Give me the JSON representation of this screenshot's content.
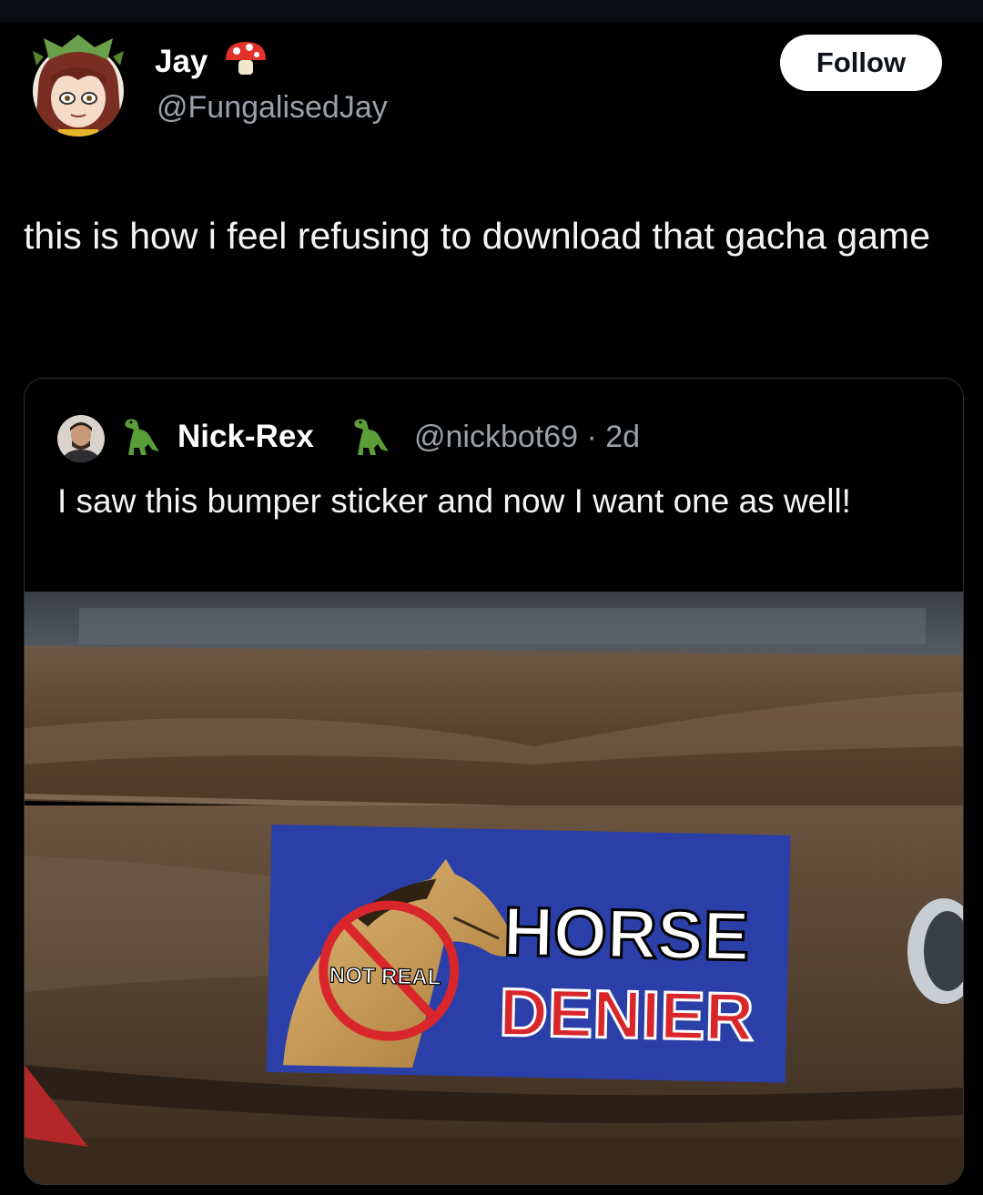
{
  "post": {
    "author_name": "Jay",
    "author_handle": "@FungalisedJay",
    "follow_label": "Follow",
    "text": "this is how i feel refusing to download that gacha game"
  },
  "quoted": {
    "author_name": "Nick-Rex",
    "author_handle": "@nickbot69 · 2d",
    "text": "I saw this bumper sticker and now I want one as well!",
    "sticker": {
      "badge_text": "NOT REAL",
      "line1": "HORSE",
      "line2": "DENIER"
    }
  },
  "icons": [
    "mushroom-icon",
    "dinosaur-icon"
  ],
  "colors": {
    "background": "#000000",
    "secondary_text": "#9aa1a8",
    "sticker_blue": "#2a3fa8",
    "sticker_red": "#d8262b",
    "car_brown": "#5e4936"
  }
}
